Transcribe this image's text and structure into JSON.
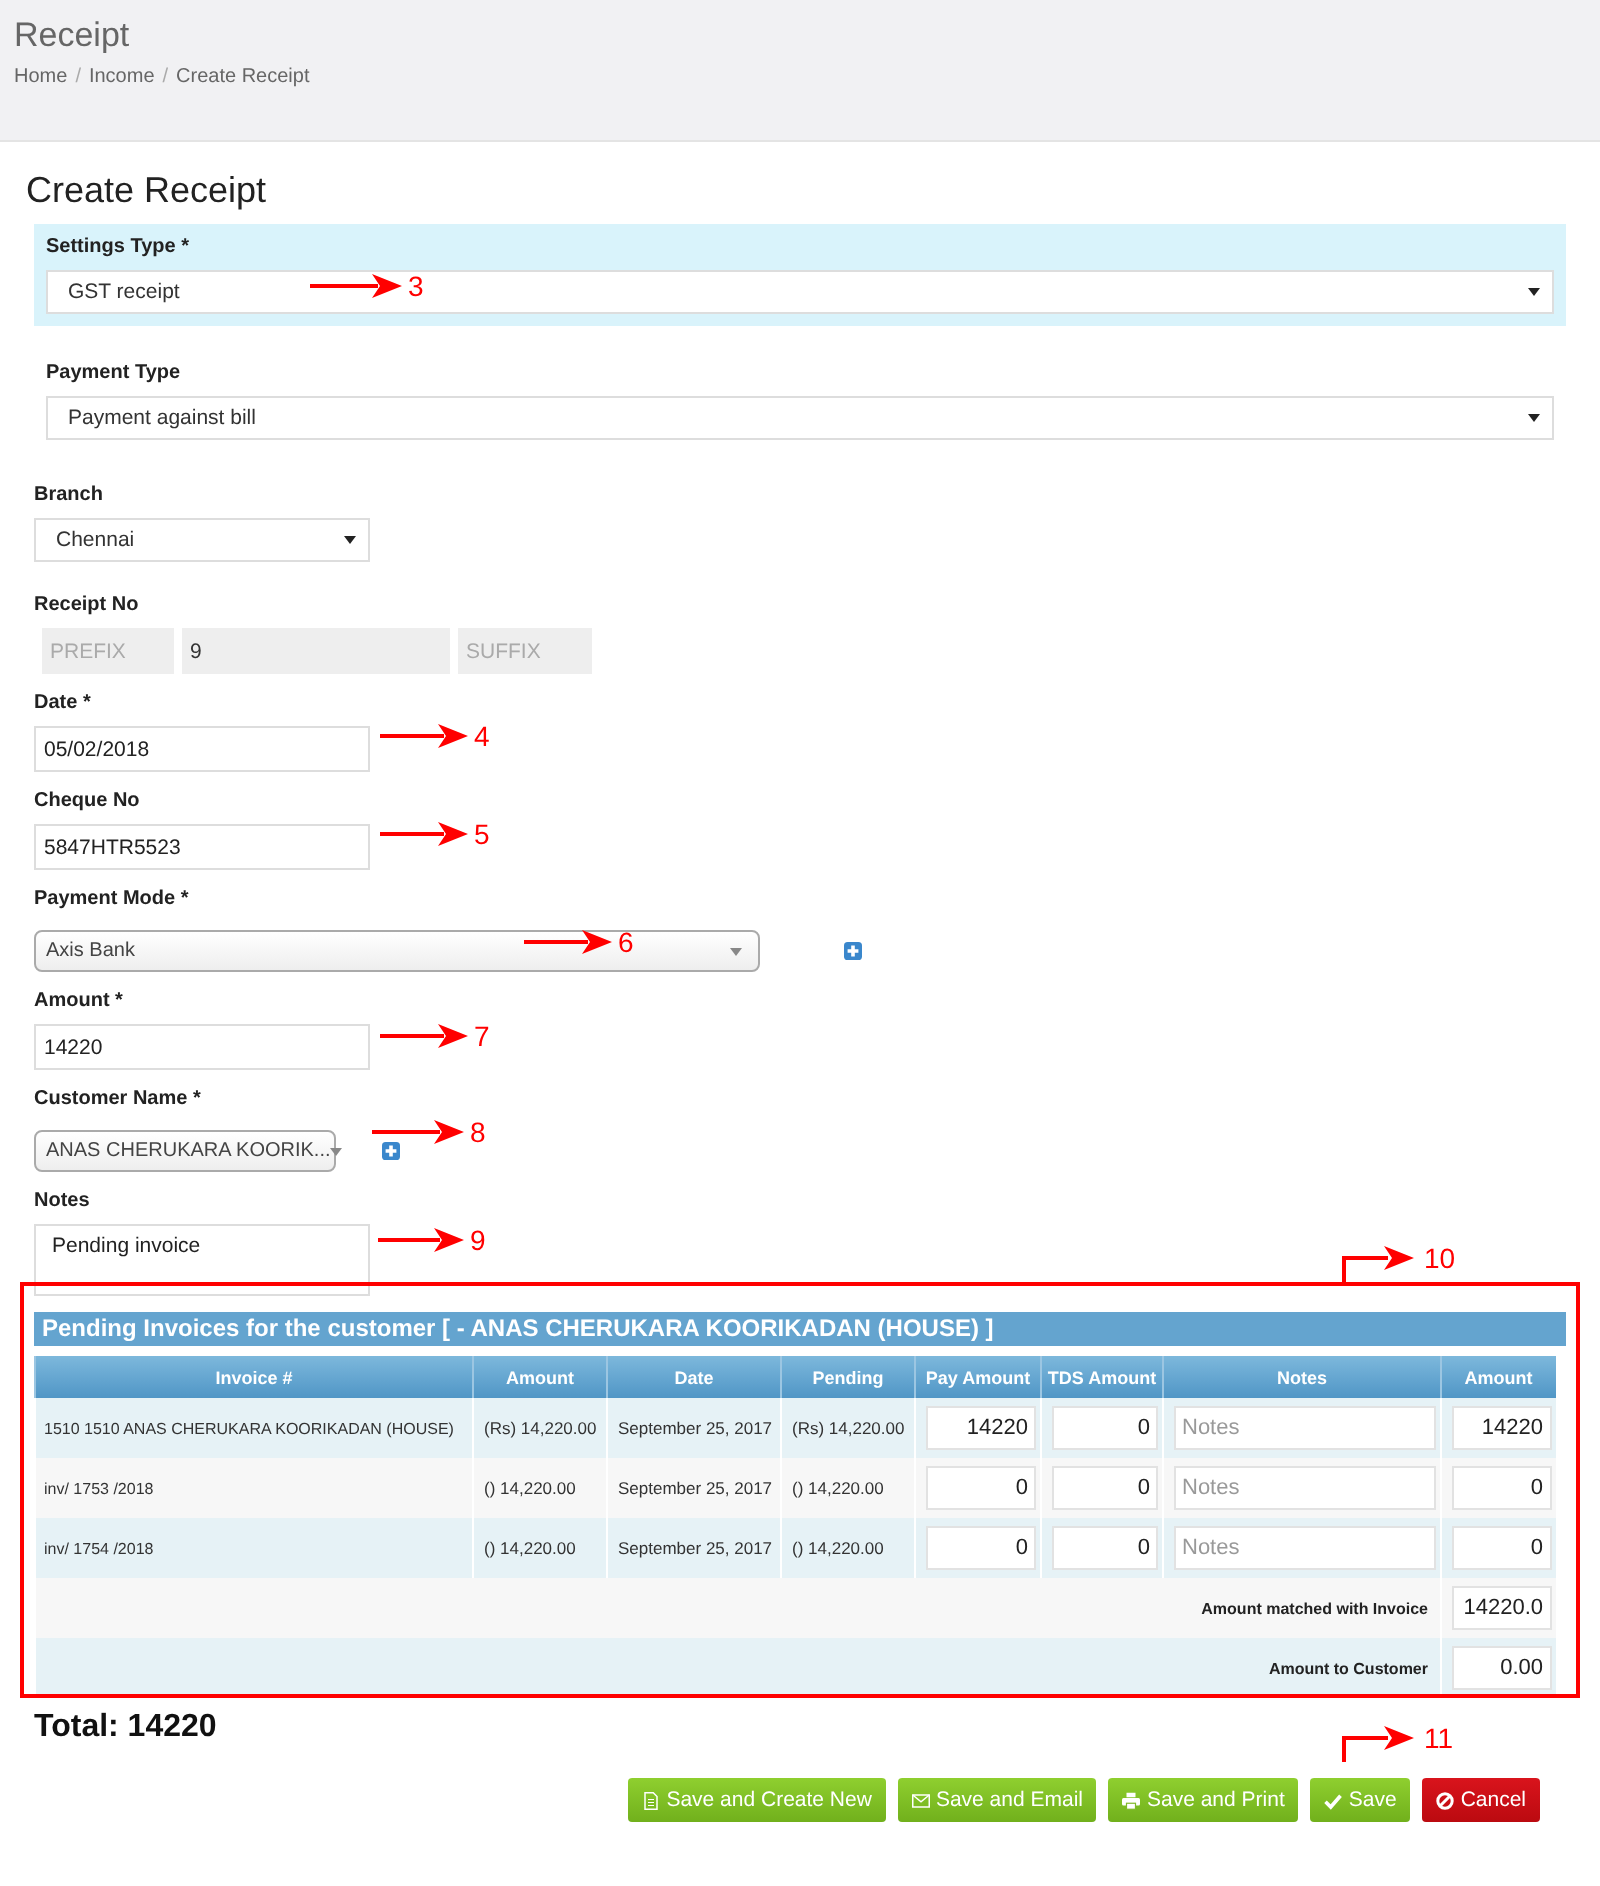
{
  "page_header": {
    "title": "Receipt",
    "breadcrumb": [
      "Home",
      "Income",
      "Create Receipt"
    ],
    "breadcrumb_separator": "/"
  },
  "form": {
    "title": "Create Receipt",
    "fields": [
      {
        "kind": "select-wide",
        "label": "Settings Type *",
        "value": "GST receipt",
        "highlighted": true
      },
      {
        "kind": "select-wide",
        "label": "Payment Type",
        "value": "Payment against bill",
        "highlighted": false
      },
      {
        "kind": "select",
        "label": "Branch",
        "value": "Chennai"
      },
      {
        "kind": "receipt-no",
        "label": "Receipt No",
        "prefix_placeholder": "PREFIX",
        "value": "9",
        "suffix_placeholder": "SUFFIX"
      },
      {
        "kind": "text",
        "label": "Date *",
        "value": "05/02/2018"
      },
      {
        "kind": "text",
        "label": "Cheque No",
        "value": "5847HTR5523"
      },
      {
        "kind": "combo-wide",
        "label": "Payment Mode *",
        "value": "Axis Bank",
        "add_button": true
      },
      {
        "kind": "text",
        "label": "Amount *",
        "value": "14220"
      },
      {
        "kind": "combo",
        "label": "Customer Name *",
        "value": "ANAS CHERUKARA KOORIK...",
        "add_button": true
      },
      {
        "kind": "textarea",
        "label": "Notes",
        "value": "Pending invoice"
      }
    ]
  },
  "pending_invoices": {
    "title": "Pending Invoices for the customer [ - ANAS CHERUKARA KOORIKADAN (HOUSE) ]",
    "columns": [
      "Invoice #",
      "Amount",
      "Date",
      "Pending",
      "Pay Amount",
      "TDS Amount",
      "Notes",
      "Amount"
    ],
    "rows": [
      {
        "invoice": "1510 1510 ANAS CHERUKARA KOORIKADAN (HOUSE)",
        "amount": "(Rs) 14,220.00",
        "date": "September 25, 2017",
        "pending": "(Rs) 14,220.00",
        "pay_amount": "14220",
        "tds_amount": "0",
        "notes_placeholder": "Notes",
        "row_amount": "14220"
      },
      {
        "invoice": "inv/ 1753 /2018",
        "amount": "() 14,220.00",
        "date": "September 25, 2017",
        "pending": "() 14,220.00",
        "pay_amount": "0",
        "tds_amount": "0",
        "notes_placeholder": "Notes",
        "row_amount": "0"
      },
      {
        "invoice": "inv/ 1754 /2018",
        "amount": "() 14,220.00",
        "date": "September 25, 2017",
        "pending": "() 14,220.00",
        "pay_amount": "0",
        "tds_amount": "0",
        "notes_placeholder": "Notes",
        "row_amount": "0"
      }
    ],
    "summary": [
      {
        "label": "Amount matched with Invoice",
        "value": "14220.0"
      },
      {
        "label": "Amount to Customer",
        "value": "0.00"
      }
    ]
  },
  "total": "Total: 14220",
  "buttons": [
    {
      "label": "Save and Create New",
      "kind": "success"
    },
    {
      "label": "Save and Email",
      "kind": "success"
    },
    {
      "label": "Save and Print",
      "kind": "success"
    },
    {
      "label": "Save",
      "kind": "success"
    },
    {
      "label": "Cancel",
      "kind": "danger"
    }
  ],
  "annotations": [
    {
      "kind": "arrow",
      "label": "3"
    },
    {
      "kind": "arrow",
      "label": "4"
    },
    {
      "kind": "arrow",
      "label": "5"
    },
    {
      "kind": "arrow",
      "label": "6"
    },
    {
      "kind": "arrow",
      "label": "7"
    },
    {
      "kind": "arrow",
      "label": "8"
    },
    {
      "kind": "arrow",
      "label": "9"
    },
    {
      "kind": "elbow-arrow",
      "label": "10",
      "highlight_box": true
    },
    {
      "kind": "elbow-arrow",
      "label": "11"
    }
  ]
}
